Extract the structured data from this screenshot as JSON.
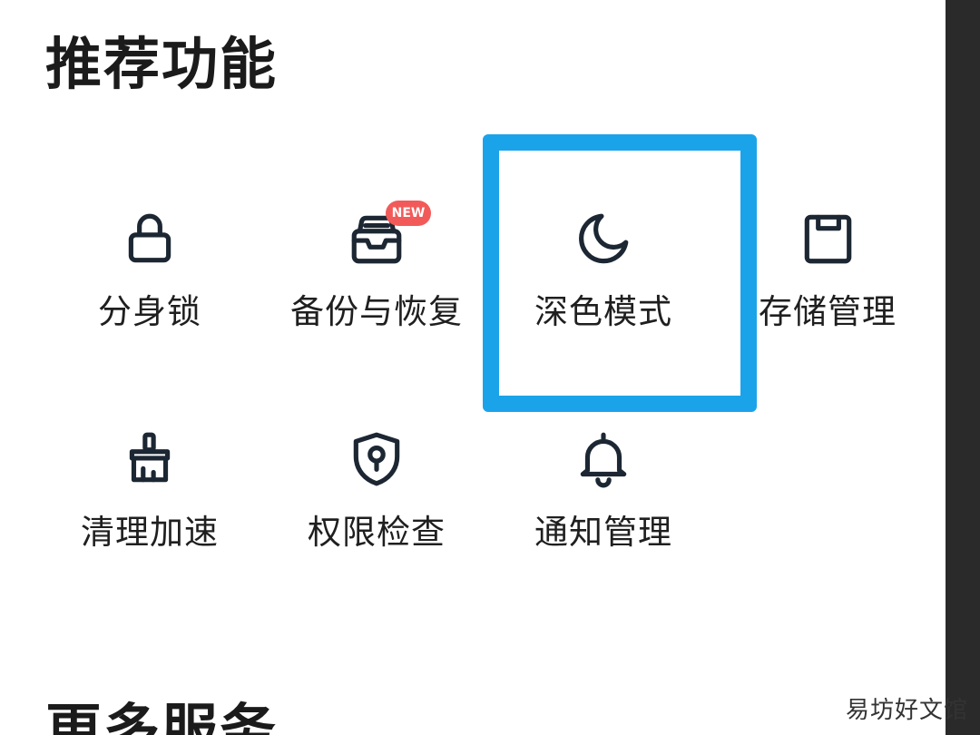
{
  "sections": {
    "recommended_title": "推荐功能",
    "more_title": "更多服务"
  },
  "features": [
    {
      "label": "分身锁",
      "icon": "lock-icon"
    },
    {
      "label": "备份与恢复",
      "icon": "inbox-tray-icon",
      "badge": "NEW"
    },
    {
      "label": "深色模式",
      "icon": "moon-icon"
    },
    {
      "label": "存储管理",
      "icon": "floppy-disk-icon"
    },
    {
      "label": "清理加速",
      "icon": "brush-icon"
    },
    {
      "label": "权限检查",
      "icon": "shield-keyhole-icon"
    },
    {
      "label": "通知管理",
      "icon": "bell-icon"
    }
  ],
  "selected_feature": "深色模式",
  "watermark": "易坊好文馆",
  "colors": {
    "background": "#ffffff",
    "text": "#1f1f1f",
    "icon_stroke": "#1c2733",
    "focus_frame": "#1ba3ea",
    "badge": "#f25a5a",
    "backdrop": "#2a2a2a"
  }
}
